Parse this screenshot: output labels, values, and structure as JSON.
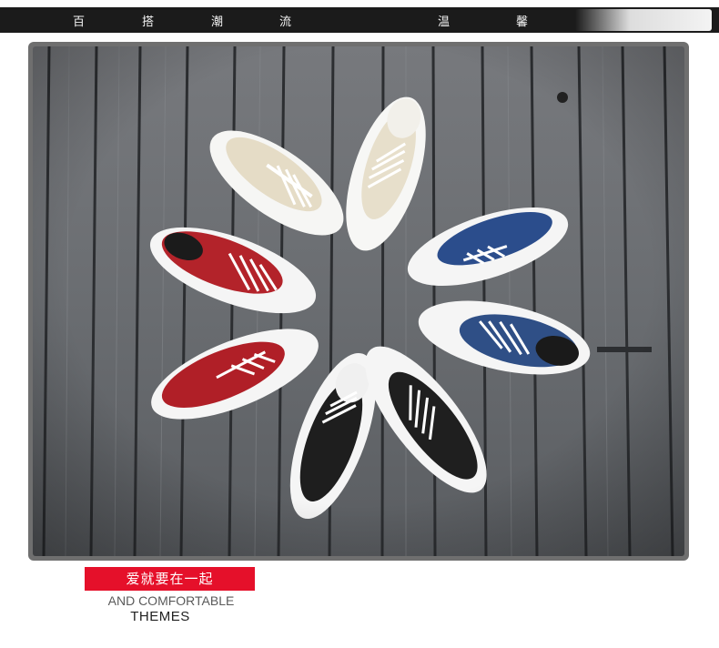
{
  "banner": {
    "left_chars": [
      "百",
      "搭",
      "潮",
      "流"
    ],
    "right_chars": [
      "温",
      "馨"
    ]
  },
  "photo": {
    "subject": "sneakers-flower-arrangement-icon",
    "shoe_colors": [
      "#e9e2cf",
      "#2b4d8c",
      "#b3232a",
      "#1e1e1e"
    ],
    "board_color": "#6b6e72"
  },
  "caption": {
    "tag": "爱就要在一起",
    "subtitle": "AND COMFORTABLE",
    "themes": "THEMES"
  },
  "colors": {
    "accent": "#e5102a",
    "banner": "#1b1b1b"
  }
}
